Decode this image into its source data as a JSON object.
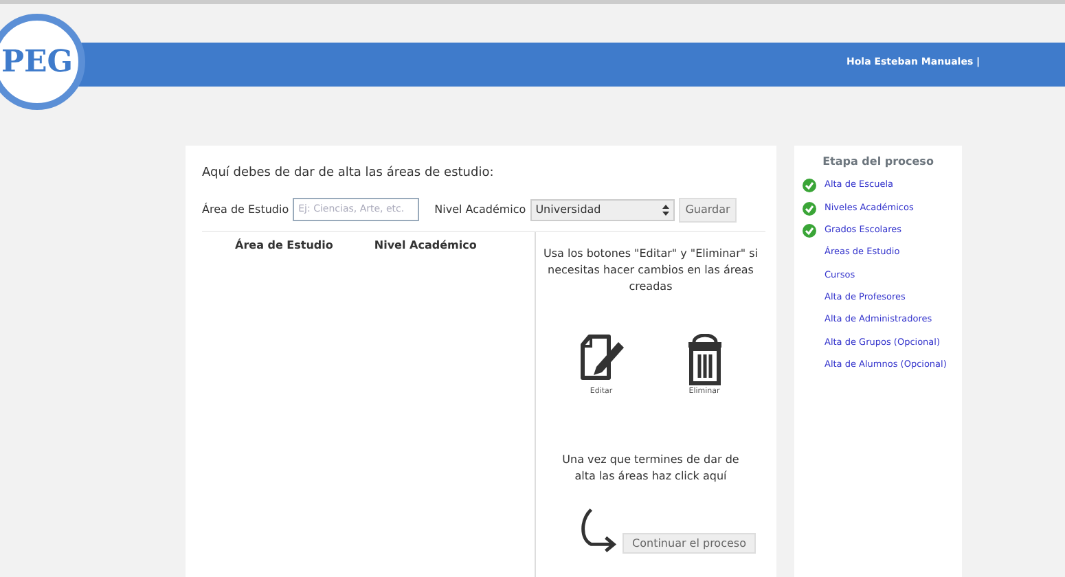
{
  "header": {
    "logo": "PEG",
    "greeting": "Hola Esteban Manuales |"
  },
  "form": {
    "intro": "Aquí debes de dar de alta las áreas de estudio:",
    "area_label": "Área de Estudio",
    "area_placeholder": "Ej: Ciencias, Arte, etc.",
    "level_label": "Nivel Académico",
    "level_value": "Universidad",
    "save_button": "Guardar"
  },
  "table": {
    "columns": [
      "Área de Estudio",
      "Nivel Académico"
    ]
  },
  "help": {
    "text": "Usa los botones \"Editar\" y \"Eliminar\" si necesitas hacer cambios en las áreas creadas",
    "edit_label": "Editar",
    "delete_label": "Eliminar",
    "continue_text": "Una vez que termines de dar de alta las áreas haz click aquí",
    "continue_button": "Continuar el proceso"
  },
  "process": {
    "title": "Etapa del proceso",
    "steps": [
      {
        "label": "Alta de Escuela",
        "completed": true
      },
      {
        "label": "Niveles Académicos",
        "completed": true
      },
      {
        "label": "Grados Escolares",
        "completed": true
      },
      {
        "label": "Áreas de Estudio",
        "completed": false
      },
      {
        "label": "Cursos",
        "completed": false
      },
      {
        "label": "Alta de Profesores",
        "completed": false
      },
      {
        "label": "Alta de Administradores",
        "completed": false
      },
      {
        "label": "Alta de Grupos (Opcional)",
        "completed": false
      },
      {
        "label": "Alta de Alumnos (Opcional)",
        "completed": false
      }
    ]
  }
}
